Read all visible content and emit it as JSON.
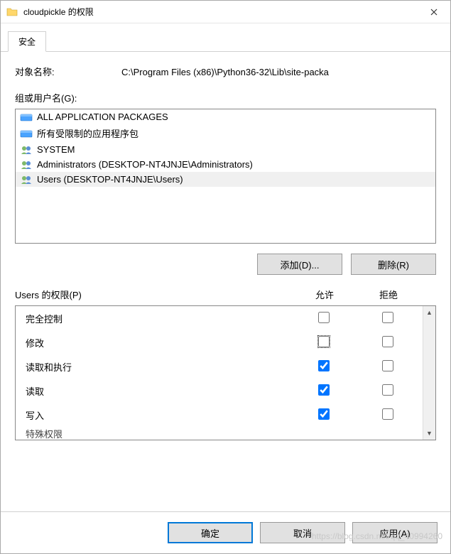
{
  "window": {
    "title": "cloudpickle 的权限"
  },
  "tab": {
    "security": "安全"
  },
  "object": {
    "label": "对象名称:",
    "path": "C:\\Program Files (x86)\\Python36-32\\Lib\\site-packa"
  },
  "groups": {
    "label": "组或用户名(G):",
    "items": [
      {
        "icon": "package",
        "name": "ALL APPLICATION PACKAGES"
      },
      {
        "icon": "package",
        "name": "所有受限制的应用程序包"
      },
      {
        "icon": "users",
        "name": "SYSTEM"
      },
      {
        "icon": "users",
        "name": "Administrators (DESKTOP-NT4JNJE\\Administrators)"
      },
      {
        "icon": "users",
        "name": "Users (DESKTOP-NT4JNJE\\Users)"
      }
    ],
    "selected_index": 4
  },
  "buttons": {
    "add": "添加(D)...",
    "remove": "删除(R)",
    "ok": "确定",
    "cancel": "取消",
    "apply": "应用(A)"
  },
  "permissions": {
    "header_label": "Users 的权限(P)",
    "allow_label": "允许",
    "deny_label": "拒绝",
    "rows": [
      {
        "name": "完全控制",
        "allow": false,
        "deny": false
      },
      {
        "name": "修改",
        "allow": false,
        "deny": false,
        "allow_focus": true
      },
      {
        "name": "读取和执行",
        "allow": true,
        "deny": false
      },
      {
        "name": "读取",
        "allow": true,
        "deny": false
      },
      {
        "name": "写入",
        "allow": true,
        "deny": false
      }
    ]
  },
  "watermark": "https://blog.csdn.net/qq_40994260"
}
